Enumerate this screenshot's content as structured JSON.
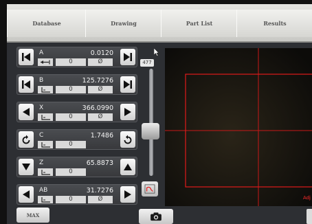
{
  "tabs": [
    {
      "label": "Database"
    },
    {
      "label": "Drawing"
    },
    {
      "label": "Part List"
    },
    {
      "label": "Results"
    }
  ],
  "axes": [
    {
      "label": "A",
      "value": "0.0120",
      "sub_value": "0",
      "sub_symbol": "Ø",
      "sub_icon": "arrow-left-bar-icon",
      "left_icon": "skip-back-icon",
      "right_icon": "skip-forward-icon"
    },
    {
      "label": "B",
      "value": "125.7276",
      "sub_value": "0",
      "sub_symbol": "Ø",
      "sub_icon": "angle-icon",
      "left_icon": "skip-back-icon",
      "right_icon": "skip-forward-icon"
    },
    {
      "label": "X",
      "value": "366.0990",
      "sub_value": "0",
      "sub_symbol": "Ø",
      "sub_icon": "angle-icon",
      "left_icon": "arrow-left-icon",
      "right_icon": "arrow-right-icon"
    },
    {
      "label": "C",
      "value": "1.7486",
      "sub_value": "0",
      "sub_symbol": "",
      "sub_icon": "angle-icon",
      "left_icon": "rotate-ccw-icon",
      "right_icon": "rotate-cw-icon"
    },
    {
      "label": "Z",
      "value": "65.8873",
      "sub_value": "0",
      "sub_symbol": "",
      "sub_icon": "angle-icon",
      "left_icon": "arrow-down-icon",
      "right_icon": "arrow-up-icon"
    },
    {
      "label": "AB",
      "value": "31.7276",
      "sub_value": "0",
      "sub_symbol": "Ø",
      "sub_icon": "angle-icon",
      "left_icon": "arrow-left-icon",
      "right_icon": "arrow-right-icon"
    }
  ],
  "slider": {
    "readout": "477",
    "level": 0.4
  },
  "view": {
    "corner_label": "Adj"
  },
  "bottom": {
    "max_label": "MAX",
    "camera_icon": "camera-icon"
  },
  "colors": {
    "view_line": "#ff2020",
    "panel": "#3e4044"
  }
}
